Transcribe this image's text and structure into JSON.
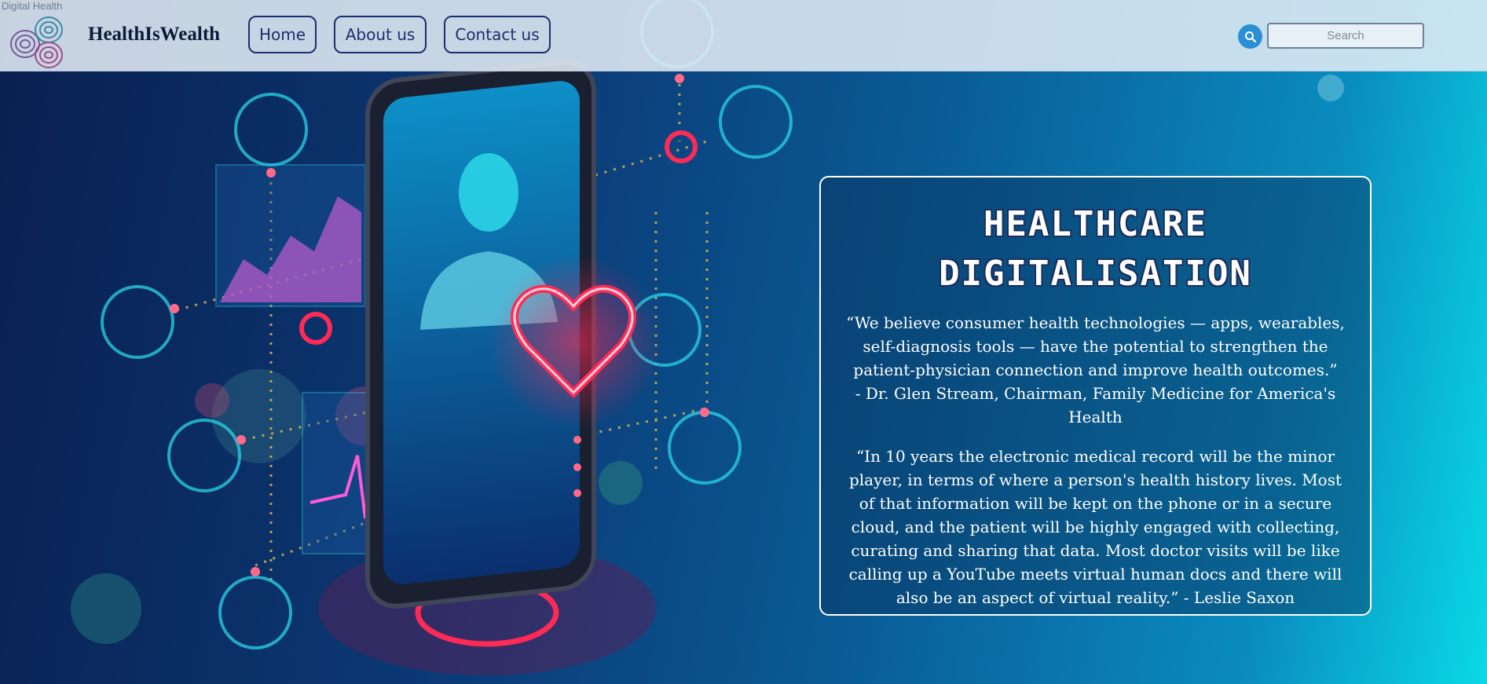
{
  "header": {
    "site_tag": "Digital Health",
    "brand": "HealthIsWealth",
    "nav": {
      "home": "Home",
      "about": "About us",
      "contact": "Contact us"
    },
    "search": {
      "placeholder": "Search"
    }
  },
  "hero": {
    "title_line1": "HEALTHCARE",
    "title_line2": "DIGITALISATION",
    "quote1_text": "“We believe consumer health technologies — apps, wearables, self-diagnosis tools — have the potential to strengthen the patient-physician connection and improve health outcomes.”",
    "quote1_author": "- Dr. Glen Stream, Chairman, Family Medicine for America's Health",
    "quote2_text": "“In 10 years the electronic medical record will be the minor player, in terms of where a person's health history lives. Most of that information will be kept on the phone or in a secure cloud, and the patient will be highly engaged with collecting, curating and sharing that data. Most doctor visits will be like calling up a YouTube meets virtual human docs and there will also be an aspect of virtual reality.” - Leslie Saxon"
  },
  "icons": {
    "logo": "fingerprint-logo-icon",
    "search": "search-icon"
  },
  "colors": {
    "nav_border": "#1c2f6e",
    "search_button": "#2a8fd4",
    "neon_accent": "#ff2a55",
    "cyan_accent": "#2ad4e6"
  }
}
